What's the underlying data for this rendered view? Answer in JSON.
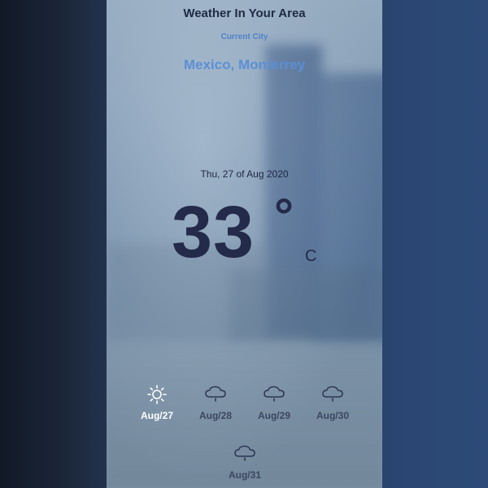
{
  "app": {
    "title": "Weather In Your Area",
    "current_city_label": "Current City",
    "city": "Mexico, Monterrey"
  },
  "current": {
    "date": "Thu, 27 of Aug 2020",
    "temperature": "33",
    "degree_symbol": "°",
    "unit": "C"
  },
  "forecast": [
    {
      "label": "Aug/27",
      "icon": "sun-icon",
      "active": true
    },
    {
      "label": "Aug/28",
      "icon": "rain-cloud-icon",
      "active": false
    },
    {
      "label": "Aug/29",
      "icon": "rain-cloud-icon",
      "active": false
    },
    {
      "label": "Aug/30",
      "icon": "rain-cloud-icon",
      "active": false
    },
    {
      "label": "Aug/31",
      "icon": "rain-cloud-icon",
      "active": false
    }
  ],
  "colors": {
    "title": "#1f2a44",
    "city_accent": "#5b8fd6",
    "temperature": "#242a4a",
    "forecast_active": "#ffffff"
  }
}
